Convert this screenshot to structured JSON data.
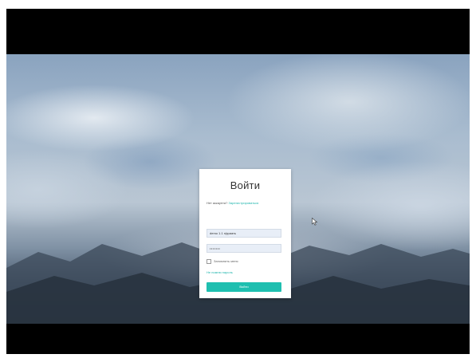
{
  "login": {
    "title": "Войти",
    "signup_prompt": "Нет аккаунта?",
    "signup_link": "Зарегистрироваться",
    "login_value": "demo 1.1 гфриать",
    "password_value": "•••••••",
    "remember_label": "Запомнить меня",
    "forgot_link": "Не помню пароль",
    "submit_label": "Войти"
  },
  "colors": {
    "accent": "#1fbfb0",
    "letterbox": "#000000"
  },
  "icons": {
    "cursor": "mouse-pointer-icon"
  }
}
